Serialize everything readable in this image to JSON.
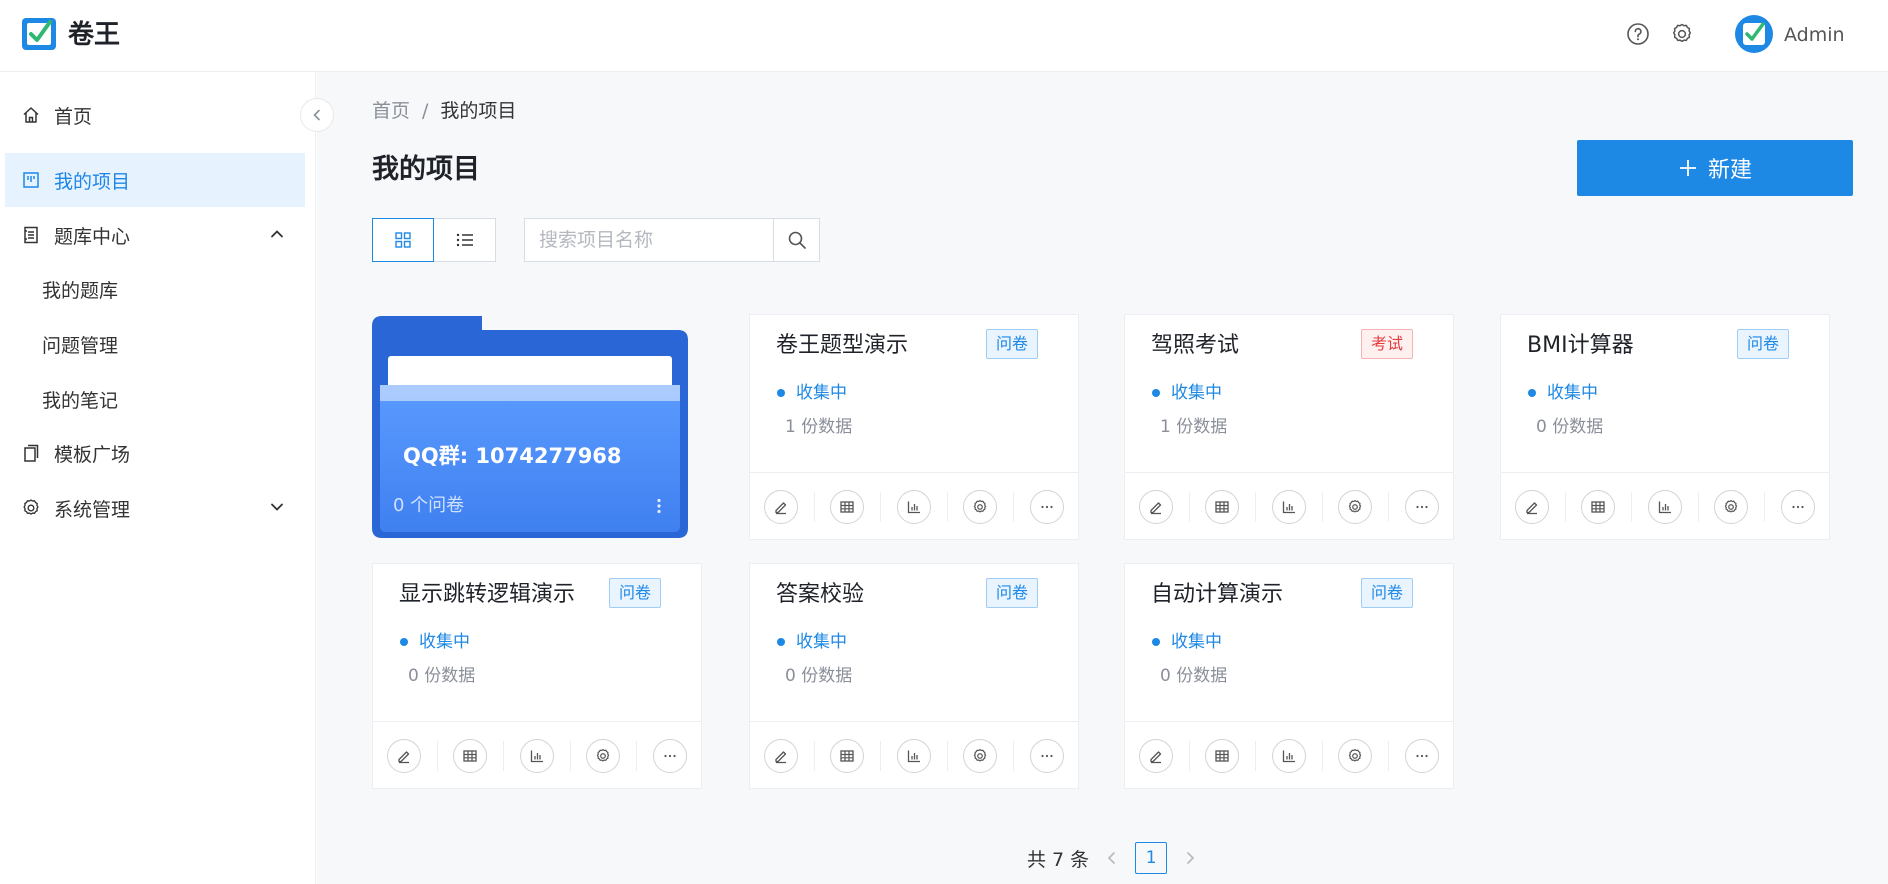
{
  "app": {
    "title": "卷王",
    "username": "Admin"
  },
  "header": {
    "icons": [
      "help-icon",
      "gear-icon"
    ]
  },
  "sidebar": {
    "items": [
      {
        "label": "首页",
        "icon": "home-icon"
      },
      {
        "label": "我的项目",
        "icon": "project-board-icon",
        "active": true
      },
      {
        "label": "题库中心",
        "icon": "question-bank-icon",
        "expanded": true
      },
      {
        "label": "我的题库"
      },
      {
        "label": "问题管理"
      },
      {
        "label": "我的笔记"
      },
      {
        "label": "模板广场",
        "icon": "template-icon"
      },
      {
        "label": "系统管理",
        "icon": "gear-icon",
        "expanded": false
      }
    ]
  },
  "breadcrumb": {
    "home": "首页",
    "separator": "/",
    "current": "我的项目"
  },
  "page": {
    "title": "我的项目",
    "new_button": "新建"
  },
  "search": {
    "placeholder": "搜索项目名称"
  },
  "folder": {
    "name": "QQ群: 1074277968",
    "count": "0 个问卷"
  },
  "projects": [
    {
      "title": "卷王题型演示",
      "tag": "问卷",
      "tag_color": "#1e88e5",
      "status": "收集中",
      "count": "1 份数据"
    },
    {
      "title": "驾照考试",
      "tag": "考试",
      "tag_color": "#e23c3c",
      "status": "收集中",
      "count": "1 份数据"
    },
    {
      "title": "BMI计算器",
      "tag": "问卷",
      "tag_color": "#1e88e5",
      "status": "收集中",
      "count": "0 份数据"
    },
    {
      "title": "显示跳转逻辑演示",
      "tag": "问卷",
      "tag_color": "#1e88e5",
      "status": "收集中",
      "count": "0 份数据"
    },
    {
      "title": "答案校验",
      "tag": "问卷",
      "tag_color": "#1e88e5",
      "status": "收集中",
      "count": "0 份数据"
    },
    {
      "title": "自动计算演示",
      "tag": "问卷",
      "tag_color": "#1e88e5",
      "status": "收集中",
      "count": "0 份数据"
    }
  ],
  "card_actions": [
    "edit-icon",
    "table-icon",
    "bar-chart-icon",
    "settings-icon",
    "more-icon"
  ],
  "pagination": {
    "total": "共 7 条",
    "current": "1"
  },
  "colors": {
    "accent": "#1e88e5",
    "folder": "#2f6fdb",
    "active_bg": "#e6f3ff"
  }
}
